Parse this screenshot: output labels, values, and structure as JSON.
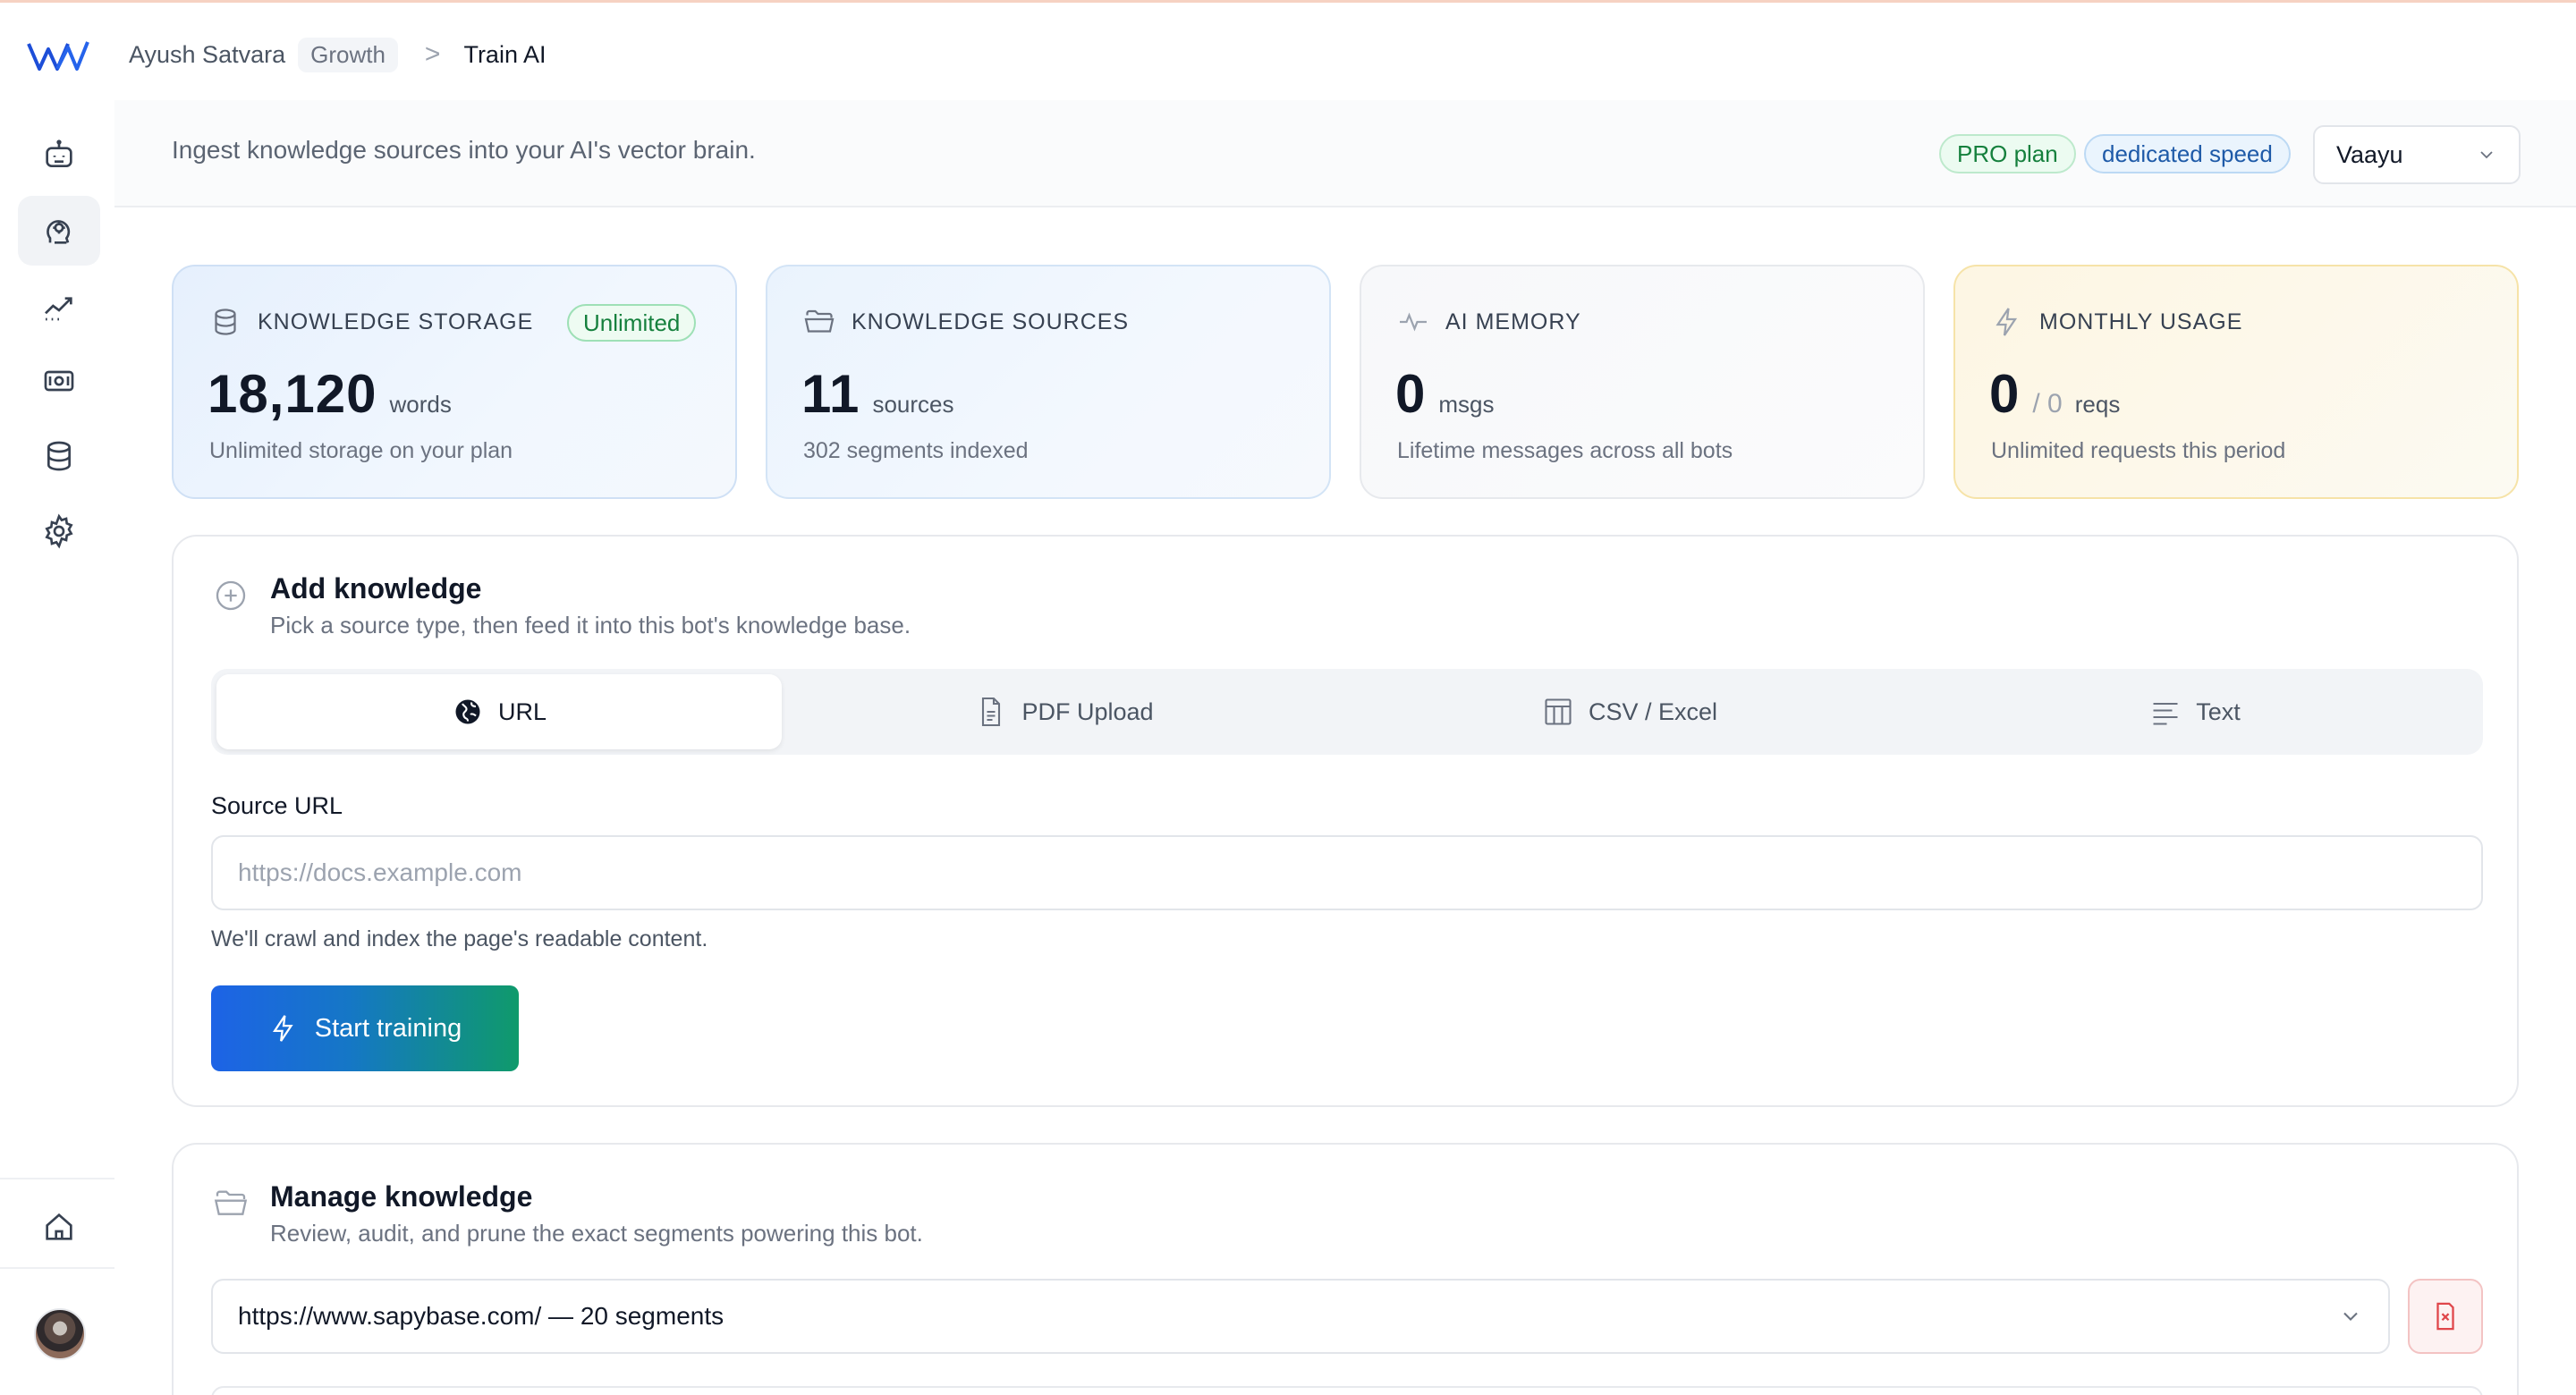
{
  "breadcrumb": {
    "user": "Ayush Satvara",
    "badge": "Growth",
    "separator": ">",
    "page": "Train AI"
  },
  "subheader": {
    "text": "Ingest knowledge sources into your AI's vector brain.",
    "plan_pill": "PRO plan",
    "speed_pill": "dedicated speed",
    "bot_select": "Vaayu"
  },
  "sidebar": {
    "items": [
      {
        "icon": "robot-icon"
      },
      {
        "icon": "brain-icon",
        "active": true
      },
      {
        "icon": "analytics-icon"
      },
      {
        "icon": "billing-icon"
      },
      {
        "icon": "database-icon"
      },
      {
        "icon": "gear-icon"
      }
    ],
    "bottom": [
      {
        "icon": "home-icon"
      },
      {
        "icon": "avatar"
      }
    ]
  },
  "stats": {
    "storage": {
      "title": "KNOWLEDGE STORAGE",
      "badge": "Unlimited",
      "value": "18,120",
      "unit": "words",
      "sub": "Unlimited storage on your plan"
    },
    "sources": {
      "title": "KNOWLEDGE SOURCES",
      "value": "11",
      "unit": "sources",
      "sub": "302 segments indexed"
    },
    "memory": {
      "title": "AI MEMORY",
      "value": "0",
      "unit": "msgs",
      "sub": "Lifetime messages across all bots"
    },
    "usage": {
      "title": "MONTHLY USAGE",
      "value": "0",
      "slash": "/ 0",
      "unit": "reqs",
      "sub": "Unlimited requests this period"
    }
  },
  "add_knowledge": {
    "title": "Add knowledge",
    "description": "Pick a source type, then feed it into this bot's knowledge base.",
    "tabs": [
      {
        "label": "URL",
        "icon": "globe-icon",
        "active": true
      },
      {
        "label": "PDF Upload",
        "icon": "document-icon"
      },
      {
        "label": "CSV / Excel",
        "icon": "table-icon"
      },
      {
        "label": "Text",
        "icon": "text-lines-icon"
      }
    ],
    "field_label": "Source URL",
    "placeholder": "https://docs.example.com",
    "value": "",
    "hint": "We'll crawl and index the page's readable content.",
    "button": "Start training"
  },
  "manage_knowledge": {
    "title": "Manage knowledge",
    "description": "Review, audit, and prune the exact segments powering this bot.",
    "selected_source": "https://www.sapybase.com/ — 20 segments"
  },
  "colors": {
    "accent_blue": "#1d63e6",
    "accent_green": "#0f9a6b",
    "pro_green": "#15803d",
    "speed_blue": "#1e5aa8",
    "danger_red": "#e0464a"
  }
}
